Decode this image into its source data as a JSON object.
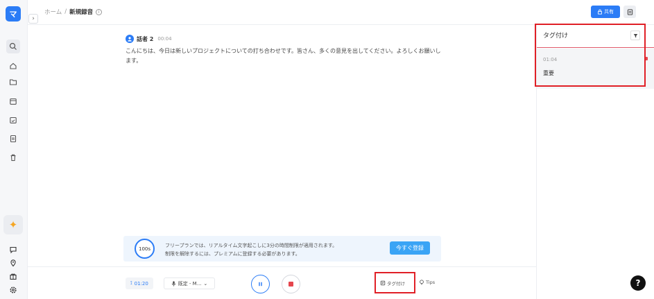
{
  "sidebar": {
    "logo_text": "マ",
    "items": [
      {
        "icon": "search-icon"
      },
      {
        "icon": "home-icon"
      },
      {
        "icon": "folder-icon"
      },
      {
        "icon": "calendar-icon"
      },
      {
        "icon": "calendar-check-icon"
      },
      {
        "icon": "document-icon"
      },
      {
        "icon": "trash-icon"
      }
    ],
    "bottom_items": [
      {
        "icon": "chat-icon"
      },
      {
        "icon": "location-pin-icon"
      },
      {
        "icon": "gift-icon"
      },
      {
        "icon": "settings-icon"
      }
    ]
  },
  "header": {
    "breadcrumb_home": "ホーム",
    "breadcrumb_sep": "/",
    "breadcrumb_current": "新規録音",
    "share_label": "共有"
  },
  "transcript": {
    "speaker": "話者 2",
    "time": "00:04",
    "text": "こんにちは、今日は新しいプロジェクトについての打ち合わせです。皆さん、多くの意見を出してください。よろしくお願いします。"
  },
  "tag_panel": {
    "title": "タグ付け",
    "items": [
      {
        "time": "01:04",
        "label": "重要"
      }
    ]
  },
  "banner": {
    "badge": "100s",
    "line1": "フリープランでは、リアルタイム文字起こしに3分の時間制限が適用されます。",
    "line2": "制限を解除するには、プレミアムに登録する必要があります。",
    "button": "今すぐ登録"
  },
  "controls": {
    "timer": "01:20",
    "device": "既定 - M...",
    "tag_label": "タグ付け",
    "tips_label": "Tips"
  },
  "help_label": "?",
  "colors": {
    "accent": "#2b7cf6",
    "highlight": "#e01f26",
    "stop": "#e5454d"
  }
}
